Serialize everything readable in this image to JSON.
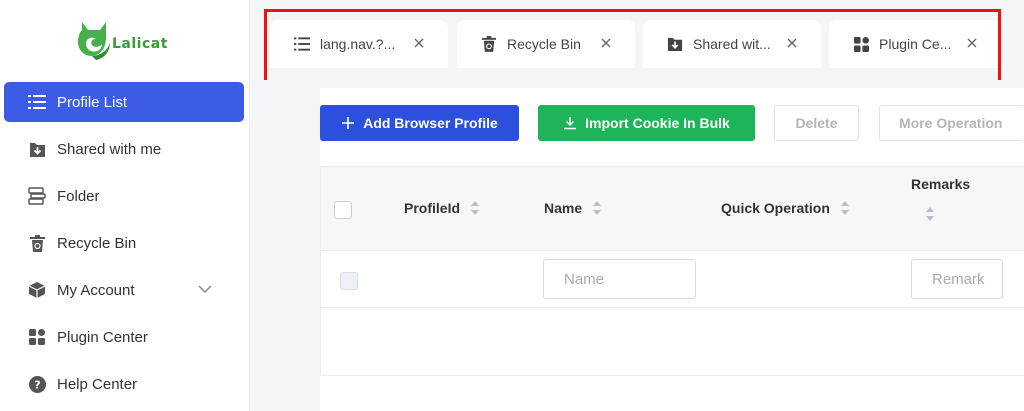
{
  "brand": {
    "name": "Lalicat"
  },
  "sidebar": {
    "items": [
      {
        "label": "Profile List",
        "icon": "list-icon",
        "active": true
      },
      {
        "label": "Shared with me",
        "icon": "download-box-icon"
      },
      {
        "label": "Folder",
        "icon": "folder-icon"
      },
      {
        "label": "Recycle Bin",
        "icon": "trash-icon"
      },
      {
        "label": "My Account",
        "icon": "cube-icon",
        "expandable": true
      },
      {
        "label": "Plugin Center",
        "icon": "grid-icon"
      },
      {
        "label": "Help Center",
        "icon": "question-icon"
      }
    ]
  },
  "tabs": [
    {
      "label": "lang.nav.?...",
      "icon": "list-icon",
      "active": true
    },
    {
      "label": "Recycle Bin",
      "icon": "trash-icon"
    },
    {
      "label": "Shared wit...",
      "icon": "download-box-icon"
    },
    {
      "label": "Plugin Ce...",
      "icon": "grid-icon"
    }
  ],
  "toolbar": {
    "add_label": "Add Browser Profile",
    "import_label": "Import Cookie In Bulk",
    "delete_label": "Delete",
    "more_label": "More Operation"
  },
  "table": {
    "columns": [
      "ProfileId",
      "Name",
      "Quick Operation",
      "Remarks"
    ],
    "filters": {
      "name_placeholder": "Name",
      "remark_placeholder": "Remark"
    }
  },
  "colors": {
    "primary": "#2d50dc",
    "success": "#1eb55a",
    "sidebar_active": "#3d5ce6",
    "highlight": "#ee1111"
  }
}
